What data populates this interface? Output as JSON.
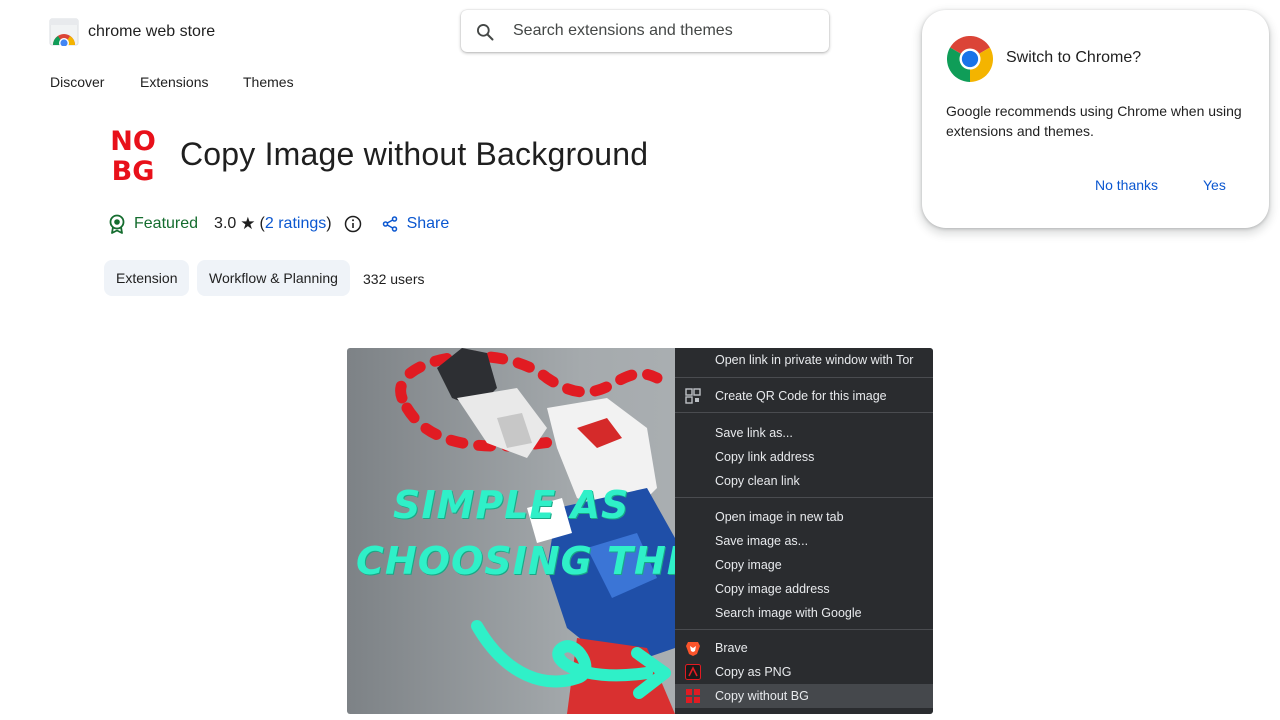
{
  "header": {
    "store_name": "chrome web store",
    "search_placeholder": "Search extensions and themes"
  },
  "nav": {
    "items": [
      {
        "label": "Discover"
      },
      {
        "label": "Extensions"
      },
      {
        "label": "Themes"
      }
    ]
  },
  "extension": {
    "logo_text_line1": "NO",
    "logo_text_line2": "BG",
    "title": "Copy Image without Background",
    "featured_label": "Featured",
    "rating_value": "3.0",
    "rating_star": "★",
    "ratings_open": "(",
    "ratings_link": "2 ratings",
    "ratings_close": ")",
    "share_label": "Share",
    "chips": [
      "Extension",
      "Workflow & Planning"
    ],
    "users": "332 users"
  },
  "screenshot": {
    "promo_line1": "SIMPLE AS",
    "promo_line2": "CHOOSING THIS!",
    "menu_items": [
      {
        "label": "Open link in private window with Tor"
      },
      {
        "label": "Create QR Code for this image",
        "icon": "qr-icon"
      },
      {
        "label": "Save link as..."
      },
      {
        "label": "Copy link address"
      },
      {
        "label": "Copy clean link"
      },
      {
        "label": "Open image in new tab"
      },
      {
        "label": "Save image as..."
      },
      {
        "label": "Copy image"
      },
      {
        "label": "Copy image address"
      },
      {
        "label": "Search image with Google"
      },
      {
        "label": "Brave",
        "icon": "brave-lion-icon"
      },
      {
        "label": "Copy as PNG",
        "icon": "png-extension-icon"
      },
      {
        "label": "Copy without BG",
        "icon": "nobg-extension-icon",
        "highlighted": true
      }
    ]
  },
  "popup": {
    "title": "Switch to Chrome?",
    "body": "Google recommends using Chrome when using extensions and themes.",
    "no_thanks": "No thanks",
    "yes": "Yes"
  },
  "colors": {
    "accent_blue": "#0b57d0",
    "featured_green": "#146c2e",
    "chip_bg": "#eff3f8",
    "logo_red": "#e8101a",
    "promo_teal": "#2ff0c8",
    "menu_bg": "#2a2c2f"
  }
}
